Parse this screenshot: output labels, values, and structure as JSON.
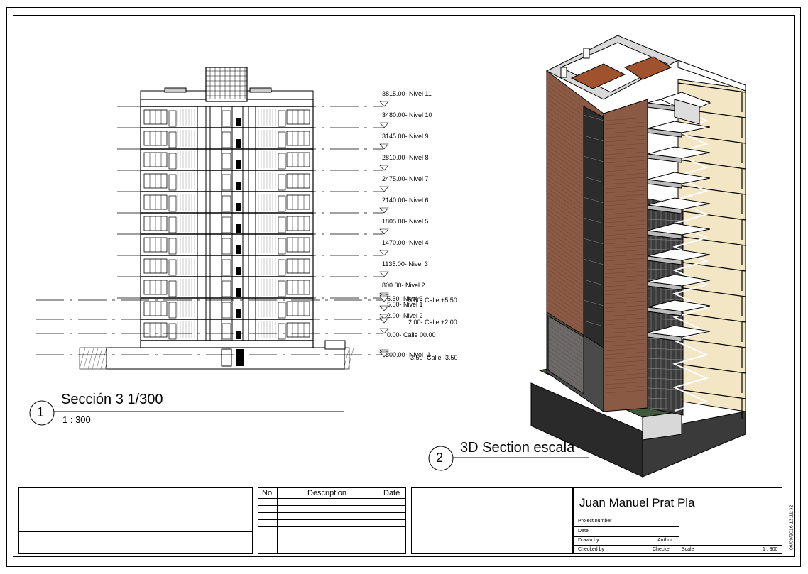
{
  "views": {
    "view1": {
      "number": "1",
      "title": "Sección 3 1/300",
      "scale": "1 : 300"
    },
    "view2": {
      "number": "2",
      "title": "3D Section escala"
    }
  },
  "levels": [
    {
      "value": "3815.00",
      "name": "Nivel 11"
    },
    {
      "value": "3480.00",
      "name": "Nivel 10"
    },
    {
      "value": "3145.00",
      "name": "Nivel 9"
    },
    {
      "value": "2810.00",
      "name": "Nivel 8"
    },
    {
      "value": "2475.00",
      "name": "Nivel 7"
    },
    {
      "value": "2140.00",
      "name": "Nivel 6"
    },
    {
      "value": "1805.00",
      "name": "Nivel 5"
    },
    {
      "value": "1470.00",
      "name": "Nivel 4"
    },
    {
      "value": "1135.00",
      "name": "Nivel 3"
    },
    {
      "value": "800.00",
      "name": "Nivel 2"
    },
    {
      "value": "5.50",
      "name": "Nivel 3"
    },
    {
      "value": "5.50",
      "name": "Calle +5.50"
    },
    {
      "value": "5.50",
      "name": "Nivel 1"
    },
    {
      "value": "2.00",
      "name": "Nivel 2"
    },
    {
      "value": "2.00",
      "name": "Calle +2.00"
    },
    {
      "value": "0.00",
      "name": "Calle 00.00"
    },
    {
      "value": "-300.00",
      "name": "Nivel -1"
    },
    {
      "value": "-3.50",
      "name": "Calle -3.50"
    }
  ],
  "revision_table": {
    "headers": [
      "No.",
      "Description",
      "Date"
    ],
    "rows": [
      [
        "",
        "",
        ""
      ],
      [
        "",
        "",
        ""
      ],
      [
        "",
        "",
        ""
      ],
      [
        "",
        "",
        ""
      ],
      [
        "",
        "",
        ""
      ],
      [
        "",
        "",
        ""
      ],
      [
        "",
        "",
        ""
      ]
    ]
  },
  "title_block": {
    "owner": "Juan Manuel Prat Pla",
    "project_number_label": "Project number",
    "date_label": "Date",
    "drawn_by_label": "Drawn by",
    "drawn_by_value": "Author",
    "checked_by_label": "Checked by",
    "checked_by_value": "Checker",
    "scale_label": "Scale",
    "scale_value": "1 : 300",
    "timestamp": "06/09/2016 13:11:32"
  },
  "colors": {
    "brick": "#8a5a44",
    "slab": "#f2e6c4",
    "glass": "#3b3b3b",
    "grass": "#3f5a3a"
  }
}
